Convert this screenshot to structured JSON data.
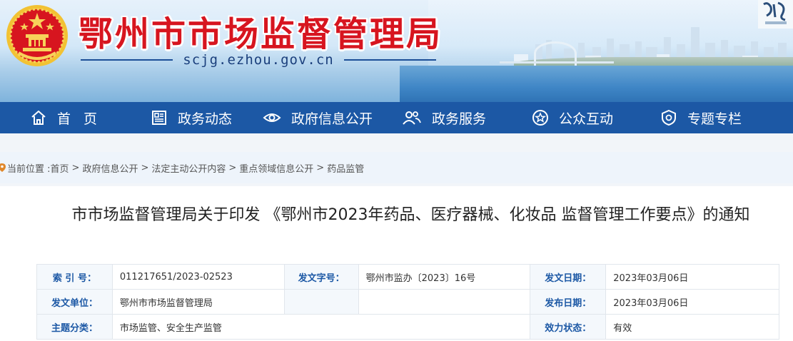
{
  "site": {
    "title": "鄂州市市场监督管理局",
    "domain": "scjg.ezhou.gov.cn"
  },
  "nav": {
    "items": [
      {
        "label": "首页",
        "icon": "home-icon"
      },
      {
        "label": "政务动态",
        "icon": "news-icon"
      },
      {
        "label": "政府信息公开",
        "icon": "eye-icon"
      },
      {
        "label": "政务服务",
        "icon": "people-icon"
      },
      {
        "label": "公众互动",
        "icon": "star-badge-icon"
      },
      {
        "label": "专题专栏",
        "icon": "shield-icon"
      }
    ]
  },
  "breadcrumb": {
    "prefix": "当前位置 :",
    "items": [
      "首页",
      "政府信息公开",
      "法定主动公开内容",
      "重点领域信息公开",
      "药品监管"
    ]
  },
  "article": {
    "title": "市市场监督管理局关于印发 《鄂州市2023年药品、医疗器械、化妆品 监督管理工作要点》的通知"
  },
  "meta": {
    "index_label": "索 引 号：",
    "index_value": "011217651/2023-02523",
    "doc_no_label": "发文字号：",
    "doc_no_value": "鄂州市监办〔2023〕16号",
    "issue_date_label": "发文日期：",
    "issue_date_value": "2023年03月06日",
    "org_label": "发文单位：",
    "org_value": "鄂州市市场监督管理局",
    "publish_date_label": "发布日期：",
    "publish_date_value": "2023年03月06日",
    "topic_label": "主题分类：",
    "topic_value": "市场监管、安全生产监管",
    "status_label": "效力状态：",
    "status_value": "有效"
  },
  "colors": {
    "nav_bg": "#1c58a5",
    "title_red": "#d7151f",
    "label_blue": "#1c58a5"
  }
}
